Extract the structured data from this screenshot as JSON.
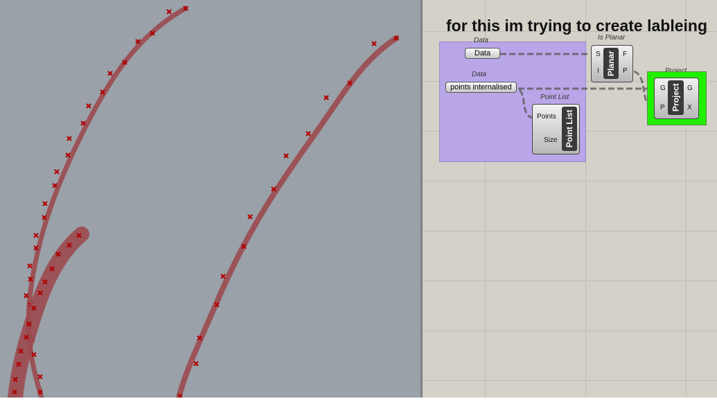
{
  "canvas": {
    "annotation": "for this im trying to create lableing",
    "data_param_1": {
      "nickname": "Data",
      "value": "Data"
    },
    "data_param_2": {
      "nickname": "Data",
      "value": "points internalised"
    },
    "is_planar": {
      "title": "Is Planar",
      "core": "Planar",
      "inputs": [
        "S",
        "I"
      ],
      "outputs": [
        "F",
        "P"
      ]
    },
    "point_list": {
      "title": "Point List",
      "core": "Point List",
      "inputs": [
        "Points",
        "Size"
      ]
    },
    "project": {
      "title": "Project",
      "core": "Project",
      "inputs": [
        "G",
        "P"
      ],
      "outputs": [
        "G",
        "X"
      ],
      "highlight": "#22ee00"
    }
  },
  "colors": {
    "viewport": "#9aa1a8",
    "curve": "#9b4a4f",
    "point": "#b00000",
    "group": "#b9a6e8"
  }
}
